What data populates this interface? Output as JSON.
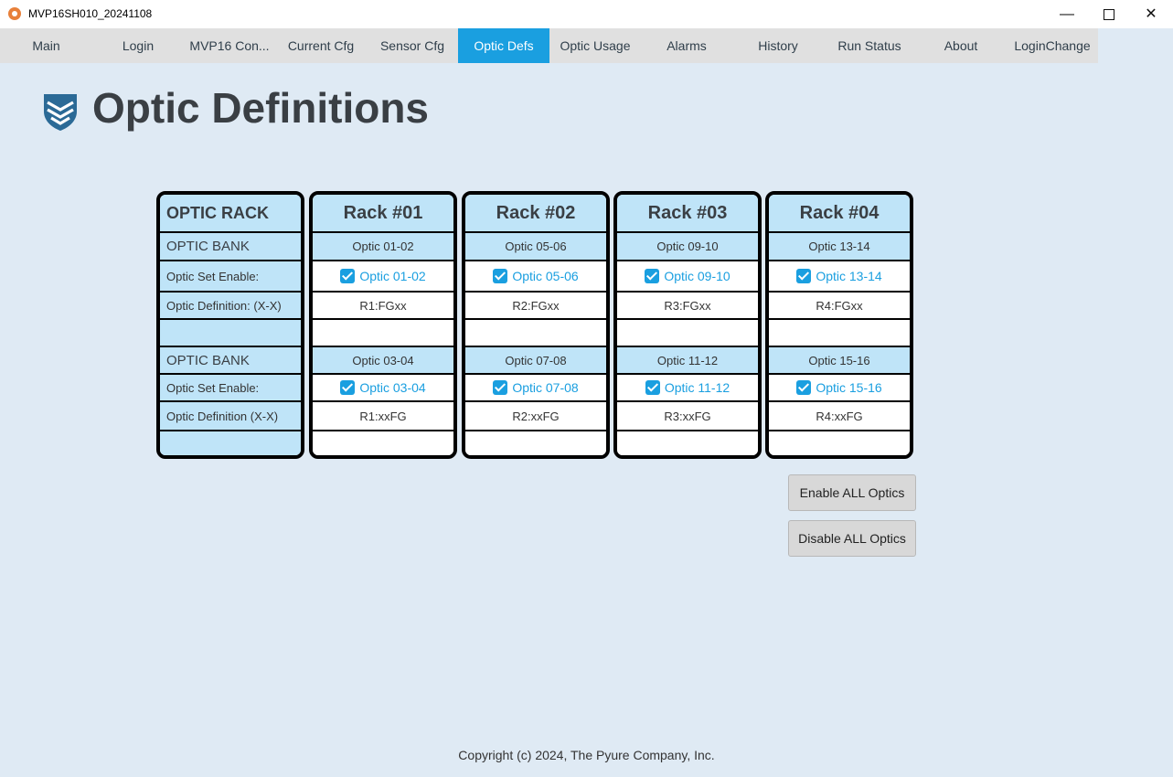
{
  "window": {
    "title": "MVP16SH010_20241108"
  },
  "tabs": [
    {
      "label": "Main"
    },
    {
      "label": "Login"
    },
    {
      "label": "MVP16 Con..."
    },
    {
      "label": "Current Cfg"
    },
    {
      "label": "Sensor Cfg"
    },
    {
      "label": "Optic Defs"
    },
    {
      "label": "Optic Usage"
    },
    {
      "label": "Alarms"
    },
    {
      "label": "History"
    },
    {
      "label": "Run Status"
    },
    {
      "label": "About"
    },
    {
      "label": "LoginChange"
    }
  ],
  "active_tab": "Optic Defs",
  "page": {
    "title": "Optic Definitions"
  },
  "labels": {
    "rack": "OPTIC RACK",
    "bank1": "OPTIC BANK",
    "enable1": "Optic Set Enable:",
    "def1": "Optic Definition: (X-X)",
    "bank2": "OPTIC BANK",
    "enable2": "Optic Set Enable:",
    "def2": "Optic Definition (X-X)"
  },
  "racks": [
    {
      "name": "Rack #01",
      "bank1": "Optic 01-02",
      "enable1": "Optic 01-02",
      "enable1_checked": true,
      "def1": "R1:FGxx",
      "bank2": "Optic 03-04",
      "enable2": "Optic 03-04",
      "enable2_checked": true,
      "def2": "R1:xxFG"
    },
    {
      "name": "Rack #02",
      "bank1": "Optic 05-06",
      "enable1": "Optic 05-06",
      "enable1_checked": true,
      "def1": "R2:FGxx",
      "bank2": "Optic 07-08",
      "enable2": "Optic 07-08",
      "enable2_checked": true,
      "def2": "R2:xxFG"
    },
    {
      "name": "Rack #03",
      "bank1": "Optic 09-10",
      "enable1": "Optic 09-10",
      "enable1_checked": true,
      "def1": "R3:FGxx",
      "bank2": "Optic 11-12",
      "enable2": "Optic 11-12",
      "enable2_checked": true,
      "def2": "R3:xxFG"
    },
    {
      "name": "Rack #04",
      "bank1": "Optic 13-14",
      "enable1": "Optic 13-14",
      "enable1_checked": true,
      "def1": "R4:FGxx",
      "bank2": "Optic 15-16",
      "enable2": "Optic 15-16",
      "enable2_checked": true,
      "def2": "R4:xxFG"
    }
  ],
  "buttons": {
    "enable_all": "Enable ALL Optics",
    "disable_all": "Disable ALL Optics"
  },
  "footer": {
    "copyright": "Copyright (c) 2024, The Pyure Company, Inc."
  },
  "colors": {
    "accent": "#1a9fe0",
    "cell_blue": "#bfe4f8",
    "background": "#dfeaf4"
  },
  "icons": {
    "app": "app-logo-icon",
    "brand": "shield-logo-icon",
    "checkbox": "checkbox-checked-icon"
  }
}
